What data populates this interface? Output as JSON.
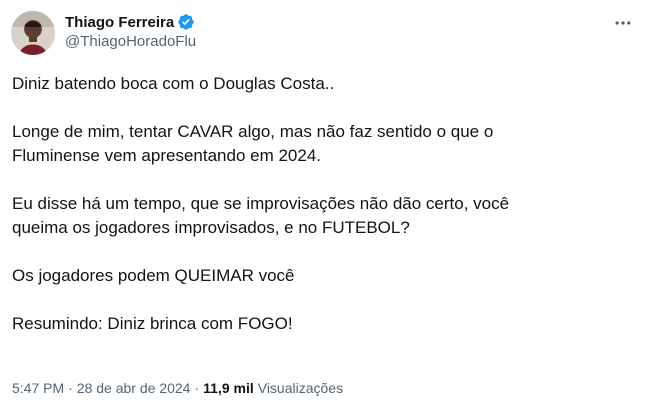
{
  "author": {
    "display_name": "Thiago Ferreira",
    "handle": "@ThiagoHoradoFlu",
    "verified": true
  },
  "tweet": {
    "paragraphs": [
      "Diniz batendo boca com o Douglas Costa..",
      "Longe de mim, tentar CAVAR algo, mas não faz sentido o que o\nFluminense vem apresentando em 2024.",
      "Eu disse há um tempo, que se improvisações não dão certo, você\nqueima os jogadores improvisados, e no FUTEBOL?",
      "Os jogadores podem QUEIMAR você",
      "Resumindo: Diniz brinca com FOGO!"
    ]
  },
  "meta": {
    "time": "5:47 PM",
    "separator": "·",
    "date": "28 de abr de 2024",
    "views_count": "11,9 mil",
    "views_label": "Visualizações"
  },
  "icons": {
    "verified": "verified-badge-icon",
    "more": "more-options-icon"
  },
  "colors": {
    "verified_blue": "#1d9bf0",
    "text_primary": "#0f1419",
    "text_secondary": "#536471"
  }
}
